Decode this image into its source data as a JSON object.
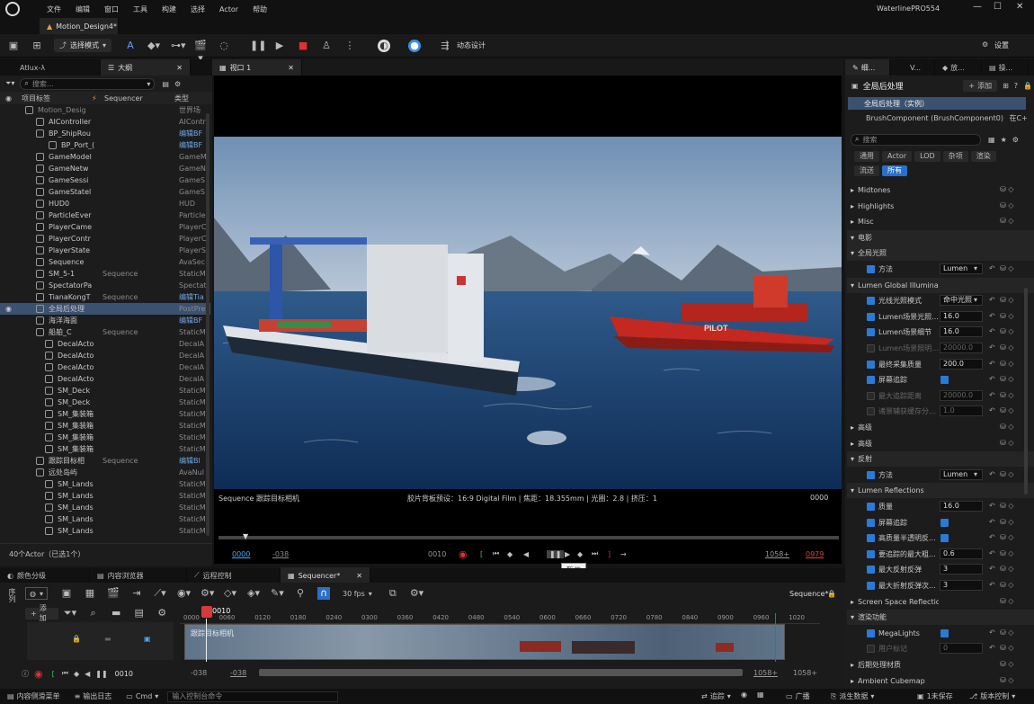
{
  "app": {
    "project": "WaterlinePRO554",
    "doc_tab": "Motion_Design4*"
  },
  "menu": [
    "文件",
    "编辑",
    "窗口",
    "工具",
    "构建",
    "选择",
    "Actor",
    "帮助"
  ],
  "toolbar": {
    "mode": "选择模式",
    "motion": "动态设计",
    "settings": "设置"
  },
  "outliner": {
    "tabs": [
      "Atlux-λ",
      "大纲"
    ],
    "search_placeholder": "搜索...",
    "col_label": "项目标签",
    "col_seq": "Sequencer",
    "col_type": "类型",
    "rows": [
      {
        "name": "Motion_Desig",
        "seq": "",
        "type": "世界场"
      },
      {
        "name": "AIController",
        "seq": "",
        "type": "AIContr"
      },
      {
        "name": "BP_ShipRou",
        "seq": "",
        "type": "编辑BF",
        "link": true
      },
      {
        "name": "BP_Port_(",
        "seq": "",
        "type": "编辑BF",
        "link": true
      },
      {
        "name": "GameModel",
        "seq": "",
        "type": "GameM"
      },
      {
        "name": "GameNetw",
        "seq": "",
        "type": "GameN"
      },
      {
        "name": "GameSessi",
        "seq": "",
        "type": "GameS"
      },
      {
        "name": "GameStatel",
        "seq": "",
        "type": "GameS"
      },
      {
        "name": "HUD0",
        "seq": "",
        "type": "HUD"
      },
      {
        "name": "ParticleEver",
        "seq": "",
        "type": "Particle"
      },
      {
        "name": "PlayerCame",
        "seq": "",
        "type": "PlayerC"
      },
      {
        "name": "PlayerContr",
        "seq": "",
        "type": "PlayerC"
      },
      {
        "name": "PlayerState",
        "seq": "",
        "type": "PlayerS"
      },
      {
        "name": "Sequence",
        "seq": "",
        "type": "AvaSec"
      },
      {
        "name": "SM_5-1",
        "seq": "Sequence",
        "type": "StaticM"
      },
      {
        "name": "SpectatorPa",
        "seq": "",
        "type": "Spectat"
      },
      {
        "name": "TianaKongT",
        "seq": "Sequence",
        "type": "编辑Tia",
        "link": true
      },
      {
        "name": "全局后处理",
        "seq": "",
        "type": "PostPre",
        "sel": true
      },
      {
        "name": "海洋海面",
        "seq": "",
        "type": "编辑BF",
        "link": true
      },
      {
        "name": "船舶_C",
        "seq": "Sequence",
        "type": "StaticM"
      },
      {
        "name": "DecalActo",
        "seq": "",
        "type": "DecalA"
      },
      {
        "name": "DecalActo",
        "seq": "",
        "type": "DecalA"
      },
      {
        "name": "DecalActo",
        "seq": "",
        "type": "DecalA"
      },
      {
        "name": "DecalActo",
        "seq": "",
        "type": "DecalA"
      },
      {
        "name": "SM_Deck",
        "seq": "",
        "type": "StaticM"
      },
      {
        "name": "SM_Deck",
        "seq": "",
        "type": "StaticM"
      },
      {
        "name": "SM_集装箱",
        "seq": "",
        "type": "StaticM"
      },
      {
        "name": "SM_集装箱",
        "seq": "",
        "type": "StaticM"
      },
      {
        "name": "SM_集装箱",
        "seq": "",
        "type": "StaticM"
      },
      {
        "name": "SM_集装箱",
        "seq": "",
        "type": "StaticM"
      },
      {
        "name": "跟踪目标相",
        "seq": "Sequence",
        "type": "编辑Bl",
        "link": true
      },
      {
        "name": "远处岛屿",
        "seq": "",
        "type": "AvaNul"
      },
      {
        "name": "SM_Lands",
        "seq": "",
        "type": "StaticM"
      },
      {
        "name": "SM_Lands",
        "seq": "",
        "type": "StaticM"
      },
      {
        "name": "SM_Lands",
        "seq": "",
        "type": "StaticM"
      },
      {
        "name": "SM_Lands",
        "seq": "",
        "type": "StaticM"
      },
      {
        "name": "SM_Lands",
        "seq": "",
        "type": "StaticM"
      }
    ],
    "count": "40个Actor（已选1个）"
  },
  "viewport": {
    "tab": "视口 1",
    "seq_label": "Sequence 跟踪目标相机",
    "info": "胶片背板预设：16:9 Digital Film | 焦距：18.355mm | 光圈：2.8 | 挤压：1",
    "frame": "0000",
    "t_start": "0000",
    "t_neg": "-038",
    "t_cur": "0010",
    "t_end1": "1058+",
    "t_end2": "0979",
    "tooltip": "暂停",
    "pilot": "PILOT"
  },
  "details": {
    "tabs": [
      "细...",
      "V...",
      "放...",
      "操..."
    ],
    "title": "全局后处理",
    "add": "添加",
    "instance": "全局后处理（实例）",
    "component": "BrushComponent (BrushComponent0)",
    "in_cpp": "在C+",
    "search_placeholder": "搜索",
    "filters": [
      "通用",
      "Actor",
      "LOD",
      "杂项",
      "渲染",
      "流送",
      "所有"
    ],
    "rows": [
      {
        "label": "Midtones",
        "kind": "sub"
      },
      {
        "label": "Highlights",
        "kind": "sub"
      },
      {
        "label": "Misc",
        "kind": "sub"
      },
      {
        "label": "电影",
        "kind": "cat"
      },
      {
        "label": "全局光照",
        "kind": "cat"
      },
      {
        "label": "方法",
        "kind": "prop",
        "value": "Lumen",
        "check": true,
        "drop": true
      },
      {
        "label": "Lumen Global Illuminatic",
        "kind": "cat"
      },
      {
        "label": "光线光照模式",
        "kind": "prop",
        "value": "命中光照",
        "check": true,
        "drop": true
      },
      {
        "label": "Lumen场景光照...",
        "kind": "prop",
        "value": "16.0",
        "check": true
      },
      {
        "label": "Lumen场景细节",
        "kind": "prop",
        "value": "16.0",
        "check": true
      },
      {
        "label": "Lumen场景照明...",
        "kind": "prop",
        "value": "20000.0",
        "check": false,
        "dim": true
      },
      {
        "label": "最终采集质量",
        "kind": "prop",
        "value": "200.0",
        "check": true
      },
      {
        "label": "屏幕追踪",
        "kind": "prop",
        "value": "",
        "check": true,
        "cb2": true
      },
      {
        "label": "最大追踪距离",
        "kind": "prop",
        "value": "20000.0",
        "check": false,
        "dim": true
      },
      {
        "label": "诸景辅获缓存分...",
        "kind": "prop",
        "value": "1.0",
        "check": false,
        "dim": true
      },
      {
        "label": "高级",
        "kind": "sub"
      },
      {
        "label": "高级",
        "kind": "sub"
      },
      {
        "label": "反射",
        "kind": "cat"
      },
      {
        "label": "方法",
        "kind": "prop",
        "value": "Lumen",
        "check": true,
        "drop": true
      },
      {
        "label": "Lumen Reflections",
        "kind": "cat"
      },
      {
        "label": "质量",
        "kind": "prop",
        "value": "16.0",
        "check": true
      },
      {
        "label": "屏幕追踪",
        "kind": "prop",
        "value": "",
        "check": true,
        "cb2": true
      },
      {
        "label": "高质量半透明反...",
        "kind": "prop",
        "value": "",
        "check": true,
        "cb2": true
      },
      {
        "label": "要追踪的最大粗...",
        "kind": "prop",
        "value": "0.6",
        "check": true
      },
      {
        "label": "最大反射反弹",
        "kind": "prop",
        "value": "3",
        "check": true
      },
      {
        "label": "最大折射反弹次...",
        "kind": "prop",
        "value": "3",
        "check": true
      },
      {
        "label": "Screen Space Reflection",
        "kind": "sub"
      },
      {
        "label": "渲染功能",
        "kind": "cat"
      },
      {
        "label": "MegaLights",
        "kind": "prop",
        "value": "",
        "check": true,
        "cb2": true
      },
      {
        "label": "用户标记",
        "kind": "prop",
        "value": "0",
        "check": false,
        "dim": true
      },
      {
        "label": "后期处理材质",
        "kind": "sub"
      },
      {
        "label": "Ambient Cubemap",
        "kind": "sub"
      }
    ]
  },
  "bottom_tabs": [
    "颜色分级",
    "内容浏览器",
    "远程控制",
    "Sequencer*"
  ],
  "sequencer": {
    "side": "序列",
    "add": "添加",
    "fps": "30 fps",
    "name": "Sequence*",
    "track": "跟踪目标相机",
    "frame": "0010",
    "ticks": [
      "0000",
      "0060",
      "0120",
      "0180",
      "0240",
      "0300",
      "0360",
      "0420",
      "0480",
      "0540",
      "0600",
      "0660",
      "0720",
      "0780",
      "0840",
      "0900",
      "0960",
      "1020"
    ],
    "cur": "0010",
    "b_neg1": "-038",
    "b_neg2": "-038",
    "b_end1": "1058+",
    "b_end2": "1058+"
  },
  "status": {
    "drawer": "内容侧滑菜单",
    "log": "输出日志",
    "cmd": "Cmd",
    "cmd_placeholder": "输入控制台命令",
    "trace": "追踪",
    "broadcast": "广播",
    "derived": "派生数据",
    "unsaved": "1未保存",
    "vc": "版本控制"
  }
}
